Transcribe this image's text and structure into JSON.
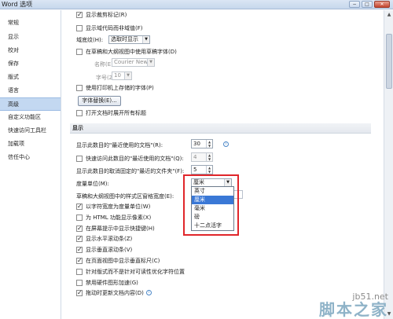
{
  "window": {
    "title": "Word 选项",
    "min": "−",
    "max": "□",
    "close": "✕"
  },
  "sidebar": {
    "items": [
      {
        "label": "常规"
      },
      {
        "label": "显示"
      },
      {
        "label": "校对"
      },
      {
        "label": "保存"
      },
      {
        "label": "版式"
      },
      {
        "label": "语言"
      },
      {
        "label": "高级",
        "active": true
      },
      {
        "label": "自定义功能区"
      },
      {
        "label": "快速访问工具栏"
      },
      {
        "label": "加载项"
      },
      {
        "label": "信任中心"
      }
    ]
  },
  "content": {
    "top_options": [
      {
        "label": "显示裁剪标记(R)",
        "checked": true
      },
      {
        "label": "显示域代码而非域值(F)",
        "checked": false
      }
    ],
    "field_shading": {
      "label": "域底纹(H):",
      "value": "选取时显示"
    },
    "draft_font_option": {
      "label": "在草稿和大纲视图中使用草稿字体(D)",
      "checked": false
    },
    "font_name": {
      "label": "名称(E):",
      "value": "Courier New"
    },
    "font_size": {
      "label": "字号(Z):",
      "value": "10"
    },
    "printer_fonts": {
      "label": "使用打印机上存储的字体(P)",
      "checked": false
    },
    "font_substitution_button": "字体替换(E)...",
    "open_doc_option": {
      "label": "打开文档时展开所有标题",
      "checked": false
    },
    "display_section": "显示",
    "recent_docs": {
      "label": "显示此数目的\"最近使用的文档\"(R):",
      "value": "30"
    },
    "quick_access_recent": {
      "label": "快速访问此数目的\"最近使用的文档\"(Q):",
      "value": "4",
      "checked": false
    },
    "unpinned_folders": {
      "label": "显示此数目的取消固定的\"最近的文件夹\"(F):",
      "value": "5"
    },
    "units": {
      "label": "度量单位(M):",
      "value": "厘米",
      "options": [
        "英寸",
        "厘米",
        "毫米",
        "磅",
        "十二点活字"
      ],
      "selected_index": 1
    },
    "style_area_width": {
      "label": "草稿和大纲视图中的样式区窗格宽度(E):"
    },
    "display_options": [
      {
        "label": "以字符宽度为度量单位(W)",
        "checked": true
      },
      {
        "label": "为 HTML 功能显示像素(X)",
        "checked": false
      },
      {
        "label": "在屏幕提示中显示快捷键(H)",
        "checked": true
      },
      {
        "label": "显示水平滚动条(Z)",
        "checked": true
      },
      {
        "label": "显示垂直滚动条(V)",
        "checked": true
      },
      {
        "label": "在页面视图中显示垂直标尺(C)",
        "checked": true
      },
      {
        "label": "针对版式而不是针对可读性优化字符位置",
        "checked": false
      },
      {
        "label": "禁用硬件图形加速(G)",
        "checked": false
      },
      {
        "label": "拖动时更新文档内容(D)",
        "checked": true
      }
    ],
    "info_icon": "i"
  },
  "watermark": {
    "url": "jb51.net",
    "name": "脚本之家"
  },
  "colors": {
    "accent": "#3a78d6",
    "highlight": "#e0262b",
    "active_nav": "#c3d8f1"
  }
}
